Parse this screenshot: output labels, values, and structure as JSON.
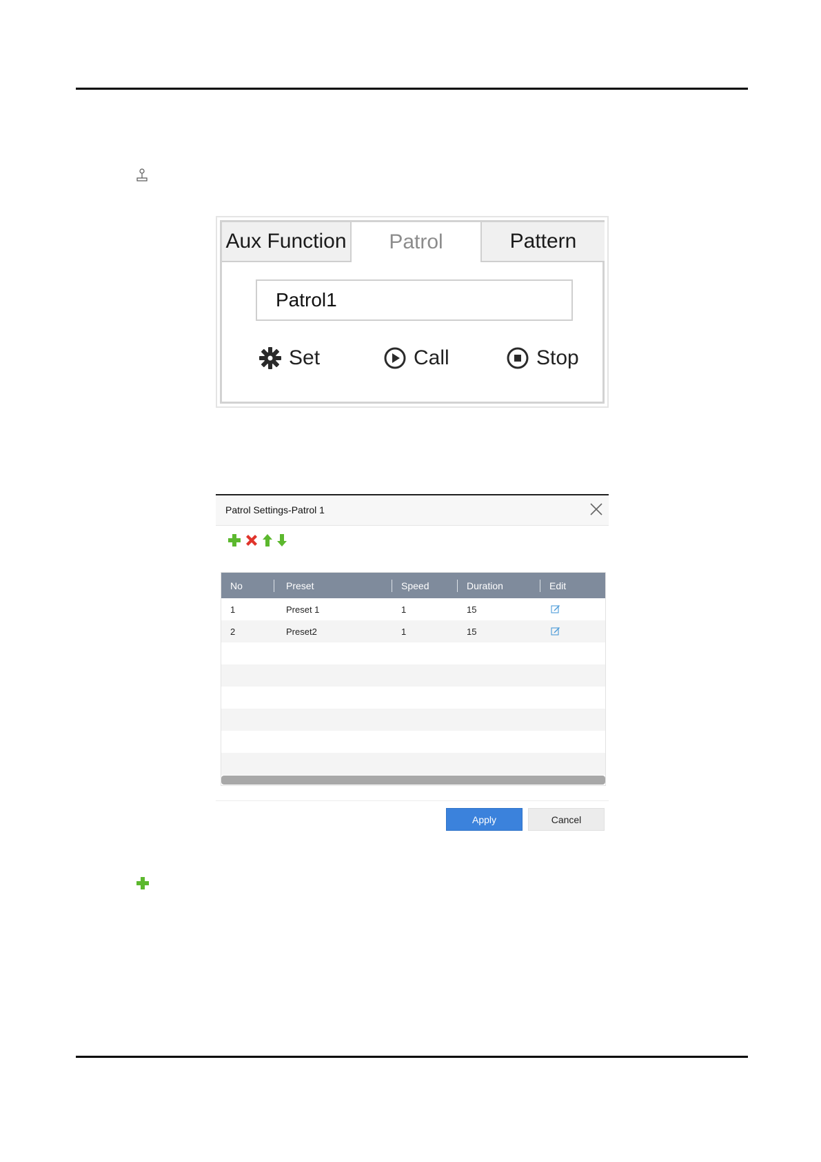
{
  "ptz_panel": {
    "tabs": [
      {
        "label": "Aux Function",
        "active": false
      },
      {
        "label": "Patrol",
        "active": true
      },
      {
        "label": "Pattern",
        "active": false
      }
    ],
    "selected_patrol": "Patrol1",
    "actions": {
      "set": "Set",
      "call": "Call",
      "stop": "Stop"
    }
  },
  "dialog": {
    "title": "Patrol Settings-Patrol 1",
    "columns": [
      "No",
      "Preset",
      "Speed",
      "Duration",
      "Edit"
    ],
    "rows": [
      {
        "no": "1",
        "preset": "Preset 1",
        "speed": "1",
        "duration": "15"
      },
      {
        "no": "2",
        "preset": "Preset2",
        "speed": "1",
        "duration": "15"
      }
    ],
    "buttons": {
      "apply": "Apply",
      "cancel": "Cancel"
    }
  },
  "colors": {
    "header_bg": "#7f8b9c",
    "apply_bg": "#3b82dc",
    "add_green": "#5cb82e",
    "delete_red": "#e0342b",
    "edit_blue": "#4a9ad8"
  },
  "icons": [
    "joystick-icon",
    "gear-icon",
    "play-circle-icon",
    "stop-circle-icon",
    "add-icon",
    "delete-icon",
    "move-up-icon",
    "move-down-icon",
    "edit-icon",
    "close-icon"
  ]
}
